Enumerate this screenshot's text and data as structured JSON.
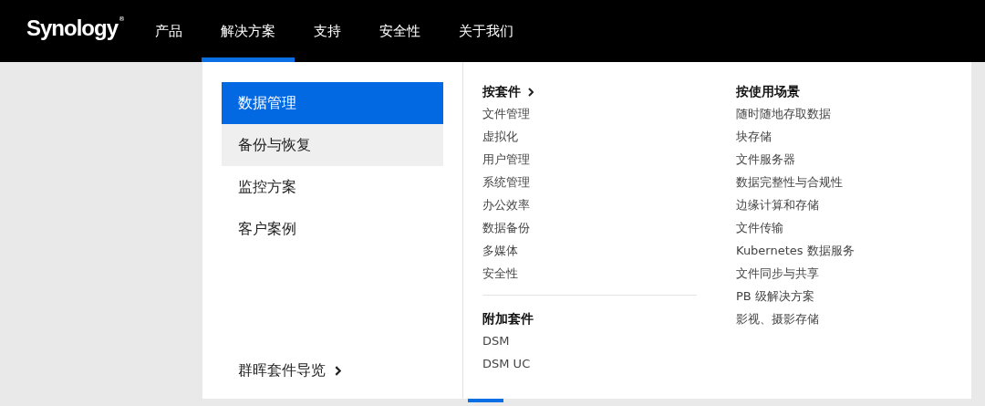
{
  "header": {
    "logo": {
      "name": "Synology",
      "mark": "®"
    },
    "nav": [
      {
        "label": "产品",
        "selected": false
      },
      {
        "label": "解决方案",
        "selected": true
      },
      {
        "label": "支持",
        "selected": false
      },
      {
        "label": "安全性",
        "selected": false
      },
      {
        "label": "关于我们",
        "selected": false
      }
    ]
  },
  "menu": {
    "categories": [
      {
        "label": "数据管理",
        "selected": true,
        "hovered": false
      },
      {
        "label": "备份与恢复",
        "selected": false,
        "hovered": true
      },
      {
        "label": "监控方案",
        "selected": false,
        "hovered": false
      },
      {
        "label": "客户案例",
        "selected": false,
        "hovered": false
      }
    ],
    "guide_link": {
      "label": "群晖套件导览"
    },
    "columns": [
      {
        "sections": [
          {
            "heading": "按套件",
            "link": true,
            "items": [
              "文件管理",
              "虚拟化",
              "用户管理",
              "系统管理",
              "办公效率",
              "数据备份",
              "多媒体",
              "安全性"
            ]
          },
          {
            "heading": "附加套件",
            "link": false,
            "items": [
              "DSM",
              "DSM UC"
            ]
          }
        ]
      },
      {
        "sections": [
          {
            "heading": "按使用场景",
            "link": false,
            "items": [
              "随时随地存取数据",
              "块存储",
              "文件服务器",
              "数据完整性与合规性",
              "边缘计算和存储",
              "文件传输",
              "Kubernetes 数据服务",
              "文件同步与共享",
              "PB 级解决方案",
              "影视、摄影存储"
            ]
          }
        ]
      }
    ]
  }
}
